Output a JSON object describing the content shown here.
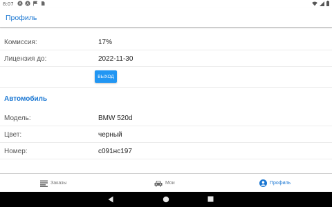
{
  "status_bar": {
    "time": "8:07",
    "left_icons": [
      "a-circle-icon",
      "a-circle-icon",
      "flag-icon",
      "sim-card-icon"
    ],
    "right_icons": [
      "wifi-icon",
      "signal-icon",
      "battery-icon"
    ]
  },
  "header": {
    "title": "Профиль"
  },
  "profile": {
    "commission": {
      "label": "Комиссия:",
      "value": "17%"
    },
    "license": {
      "label": "Лицензия до:",
      "value": "2022-11-30"
    },
    "logout_label": "выход"
  },
  "car": {
    "section_title": "Автомобиль",
    "model": {
      "label": "Модель:",
      "value": "BMW 520d"
    },
    "color": {
      "label": "Цвет:",
      "value": "черный"
    },
    "plate": {
      "label": "Номер:",
      "value": "с091нс197"
    }
  },
  "bottom_nav": {
    "tabs": [
      {
        "label": "Заказы",
        "icon": "list-icon",
        "active": false
      },
      {
        "label": "Мои",
        "icon": "car-icon",
        "active": false
      },
      {
        "label": "Профиль",
        "icon": "account-icon",
        "active": true
      }
    ]
  },
  "system_nav": {
    "buttons": [
      "back-icon",
      "home-icon",
      "recents-icon"
    ]
  },
  "colors": {
    "accent": "#1976d2",
    "button": "#2196f3",
    "inactive": "#777777"
  }
}
